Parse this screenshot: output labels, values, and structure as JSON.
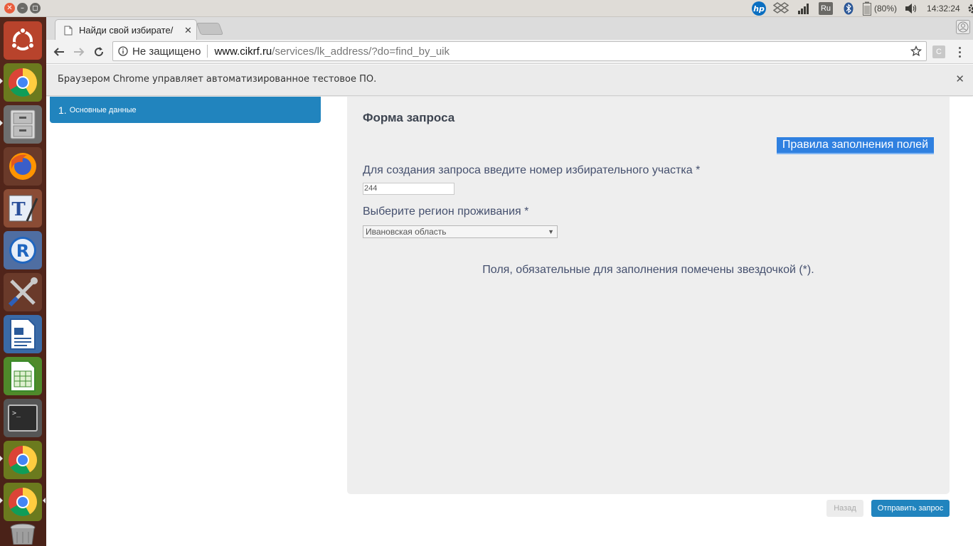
{
  "top_panel": {
    "keyboard_layout": "Ru",
    "battery": "(80%)",
    "clock": "14:32:24",
    "icons": [
      "hp-icon",
      "dropbox-icon",
      "network-signal-icon",
      "keyboard-layout-icon",
      "bluetooth-icon",
      "battery-icon",
      "volume-icon",
      "settings-gear-icon"
    ]
  },
  "launcher": {
    "items": [
      "ubuntu-dash",
      "chrome",
      "files",
      "firefox",
      "texstudio",
      "r",
      "system-settings",
      "libreoffice-writer",
      "libreoffice-calc",
      "terminal",
      "chrome",
      "chrome",
      "trash"
    ]
  },
  "browser": {
    "tab_title": "Найди свой избирате/",
    "tab_close": "✕",
    "address": {
      "security_label": "Не защищено",
      "host": "www.cikrf.ru",
      "path": "/services/lk_address/?do=find_by_uik"
    },
    "extension_label": "C",
    "infobar_text": "Браузером Chrome управляет автоматизированное тестовое ПО.",
    "infobar_close": "✕"
  },
  "page": {
    "step": {
      "number": "1.",
      "label": "Основные данные"
    },
    "form": {
      "title": "Форма запроса",
      "rules_button": "Правила заполнения полей",
      "uik_label": "Для создания запроса введите номер избирательного участка *",
      "uik_value": "244",
      "region_label": "Выберите регион проживания *",
      "region_value": "Ивановская область",
      "required_note": "Поля, обязательные для заполнения помечены звездочкой (*)."
    },
    "back_button": "Назад",
    "submit_button": "Отправить запрос"
  },
  "colors": {
    "accent": "#2184be",
    "rules_button": "#2f80e0",
    "label_text": "#45506e",
    "launcher_bg": "#4f2419",
    "panel_bg": "#eeeeee"
  }
}
